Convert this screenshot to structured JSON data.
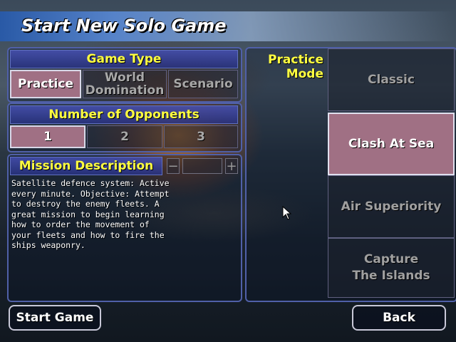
{
  "title": "Start New Solo Game",
  "game_type": {
    "header": "Game Type",
    "options": [
      "Practice",
      "World Domination",
      "Scenario"
    ],
    "selected": "Practice"
  },
  "opponents": {
    "header": "Number of Opponents",
    "options": [
      "1",
      "2",
      "3"
    ],
    "selected": "1"
  },
  "mission": {
    "header": "Mission Description",
    "minus": "−",
    "plus": "+",
    "text": "Satellite defence system: Active\nevery minute. Objective: Attempt\nto destroy the enemy fleets. A\ngreat mission to begin learning\nhow to order the movement of\nyour fleets and how to fire the\nships weaponry."
  },
  "practice_mode": {
    "label": "Practice Mode",
    "options": [
      "Classic",
      "Clash At Sea",
      "Air Superiority",
      "Capture\nThe Islands"
    ],
    "selected": "Clash At Sea"
  },
  "buttons": {
    "start": "Start Game",
    "back": "Back"
  },
  "colors": {
    "header_text": "#ffff40",
    "selected_bg": "#a07084",
    "panel_border": "#5060a8"
  }
}
